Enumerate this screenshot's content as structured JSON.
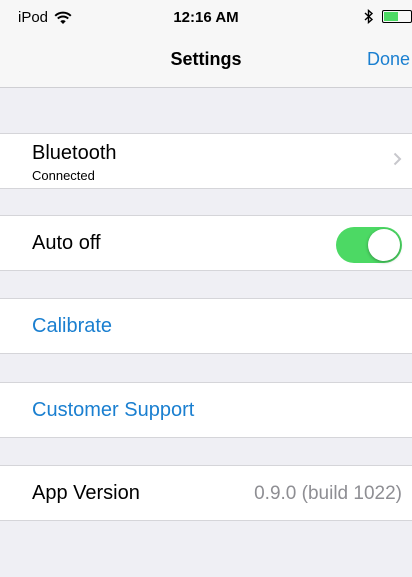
{
  "status_bar": {
    "carrier": "iPod",
    "time": "12:16 AM",
    "battery_level": 0.55,
    "battery_color": "#4cd964",
    "icons": [
      "wifi-icon",
      "bluetooth-icon",
      "battery-icon"
    ]
  },
  "nav": {
    "title": "Settings",
    "done_label": "Done"
  },
  "settings": {
    "bluetooth": {
      "label": "Bluetooth",
      "subtitle": "Connected",
      "accessory": "chevron-right-icon"
    },
    "auto_off": {
      "label": "Auto off",
      "enabled": true
    },
    "calibrate": {
      "label": "Calibrate"
    },
    "customer_support": {
      "label": "Customer Support"
    },
    "app_version": {
      "label": "App Version",
      "value": "0.9.0 (build 1022)"
    }
  },
  "colors": {
    "accent": "#1a7fd0",
    "toggle_on": "#4cd964",
    "background": "#efeff4",
    "secondary_text": "#8e8e93"
  }
}
